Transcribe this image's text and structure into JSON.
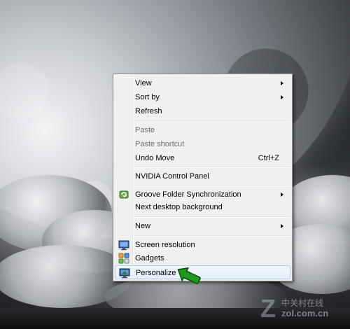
{
  "menu": {
    "items": [
      {
        "label": "View",
        "submenu": true
      },
      {
        "label": "Sort by",
        "submenu": true
      },
      {
        "label": "Refresh"
      },
      {
        "label": "Paste",
        "disabled": true
      },
      {
        "label": "Paste shortcut",
        "disabled": true
      },
      {
        "label": "Undo Move",
        "shortcut": "Ctrl+Z"
      },
      {
        "label": "NVIDIA Control Panel"
      },
      {
        "label": "Groove Folder Synchronization",
        "submenu": true,
        "icon": "groove-icon"
      },
      {
        "label": "Next desktop background"
      },
      {
        "label": "New",
        "submenu": true
      },
      {
        "label": "Screen resolution",
        "icon": "monitor-icon"
      },
      {
        "label": "Gadgets",
        "icon": "gadgets-icon"
      },
      {
        "label": "Personalize",
        "icon": "personalize-icon",
        "highlighted": true
      }
    ]
  },
  "watermark": {
    "chinese": "中关村在线",
    "english": "zol.com.cn",
    "letter": "Z"
  },
  "colors": {
    "menu_bg": "#f0f0f0",
    "highlight_border": "#aecff7",
    "pointer": "#1f9a1f"
  }
}
